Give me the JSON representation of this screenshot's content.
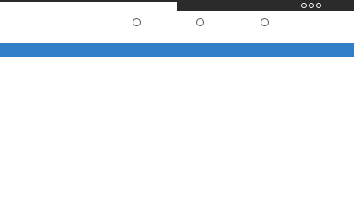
{
  "window": {
    "controls": [
      {
        "name": "window-control-1"
      },
      {
        "name": "window-control-2"
      },
      {
        "name": "window-control-3"
      }
    ]
  },
  "options": [
    {
      "name": "option-1"
    },
    {
      "name": "option-2"
    },
    {
      "name": "option-3"
    }
  ],
  "colors": {
    "titlebar": "#2b2b2b",
    "accent": "#2f7ec6",
    "background": "#ffffff"
  }
}
